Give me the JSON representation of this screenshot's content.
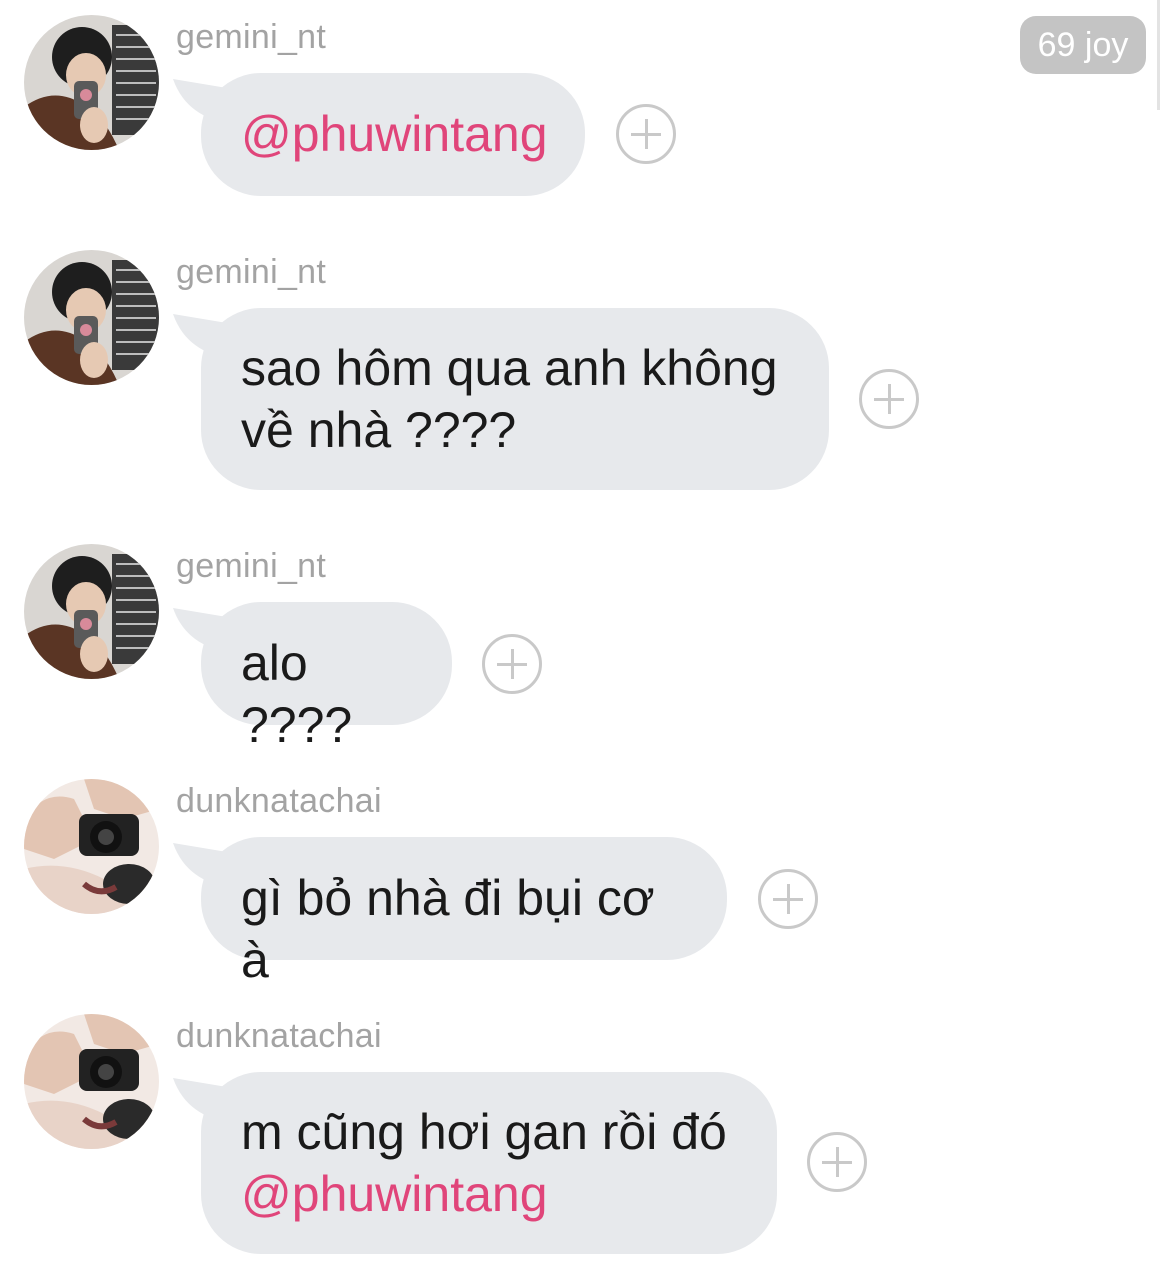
{
  "badge": {
    "label": "69 joy"
  },
  "messages": [
    {
      "username": "gemini_nt",
      "avatar_icon": "avatar-gemini",
      "lines": [
        {
          "mention": "@phuwintang"
        }
      ]
    },
    {
      "username": "gemini_nt",
      "avatar_icon": "avatar-gemini",
      "lines": [
        {
          "text": "sao hôm qua anh không"
        },
        {
          "text": "về nhà ????"
        }
      ]
    },
    {
      "username": "gemini_nt",
      "avatar_icon": "avatar-gemini",
      "lines": [
        {
          "text": "alo ????"
        }
      ]
    },
    {
      "username": "dunknatachai",
      "avatar_icon": "avatar-dunk",
      "lines": [
        {
          "text": "gì bỏ nhà đi bụi cơ à"
        }
      ]
    },
    {
      "username": "dunknatachai",
      "avatar_icon": "avatar-dunk",
      "lines": [
        {
          "text": "m cũng hơi gan rồi đó"
        },
        {
          "mention": "@phuwintang"
        }
      ]
    }
  ],
  "colors": {
    "bubble": "#e7e9ec",
    "mention": "#e0457a",
    "username": "#a3a3a3",
    "badge": "#c4c4c4"
  }
}
